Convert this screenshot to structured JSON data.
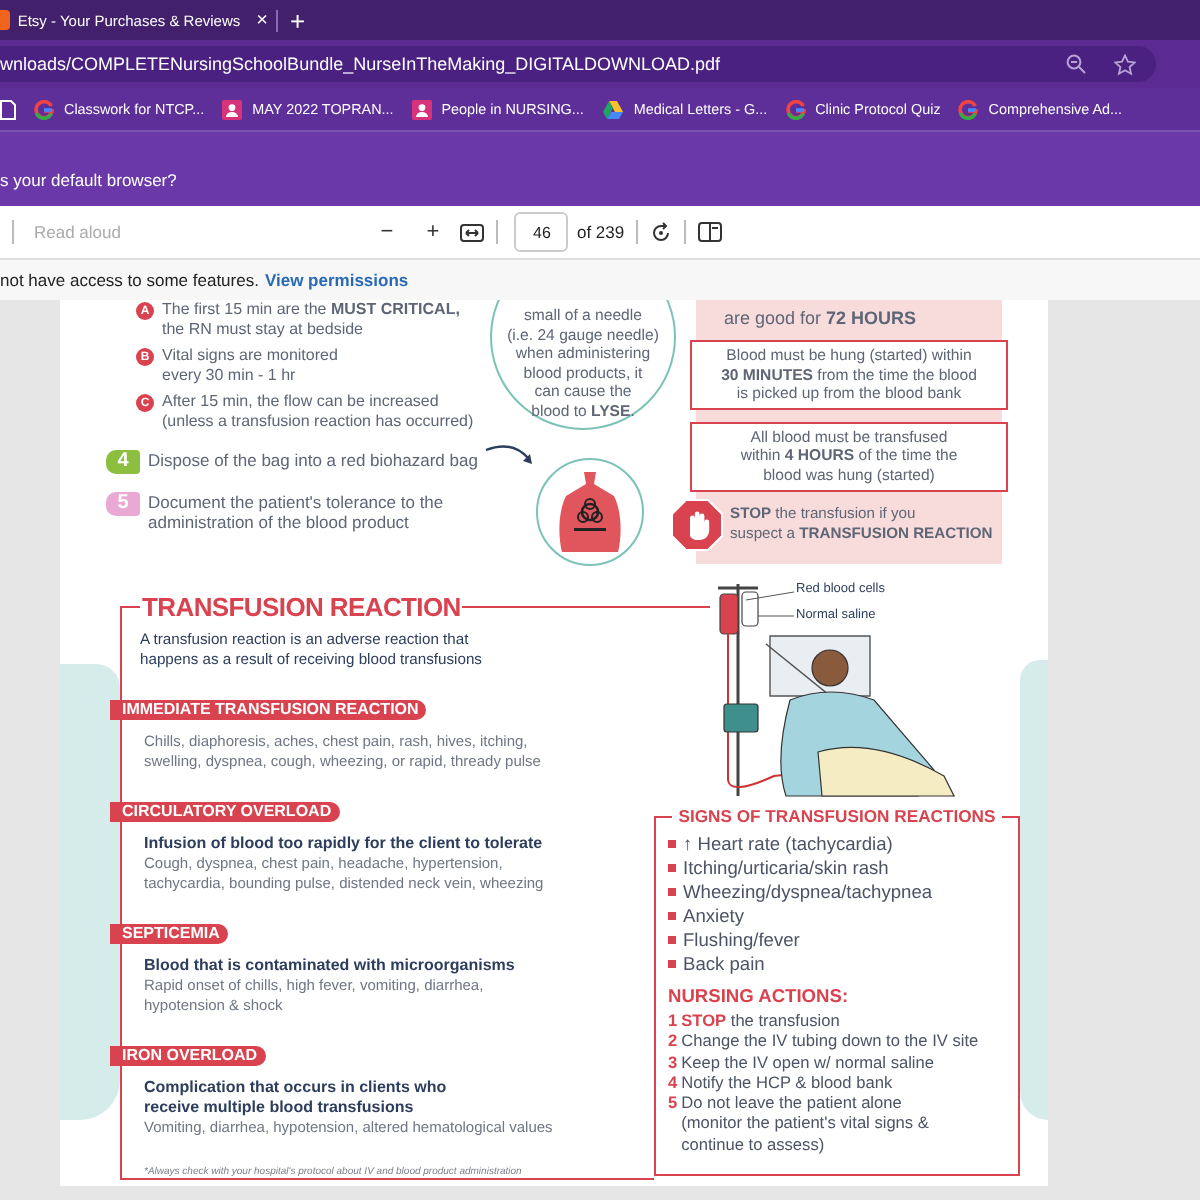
{
  "browser": {
    "tab": {
      "title": "Etsy - Your Purchases & Reviews",
      "close": "×"
    },
    "new_tab": "+",
    "address": "wnloads/COMPLETENursingSchoolBundle_NurseInTheMaking_DIGITALDOWNLOAD.pdf",
    "bookmarks": [
      {
        "kind": "page"
      },
      {
        "kind": "g",
        "label": "Classwork for NTCP..."
      },
      {
        "kind": "person",
        "label": "MAY 2022 TOPRAN..."
      },
      {
        "kind": "person",
        "label": "People in NURSING..."
      },
      {
        "kind": "drive",
        "label": "Medical Letters - G..."
      },
      {
        "kind": "g",
        "label": "Clinic Protocol Quiz"
      },
      {
        "kind": "g",
        "label": "Comprehensive Ad..."
      }
    ],
    "prompt": "s your default browser?"
  },
  "pdf_toolbar": {
    "read_aloud": {
      "label": "Read aloud",
      "disabled": true
    },
    "zoom_out": "−",
    "zoom_in": "+",
    "page": "46",
    "page_count": "of 239"
  },
  "info_bar": {
    "message": "not have access to some features.",
    "link": "View permissions"
  },
  "page": {
    "substeps": [
      {
        "marker": "A",
        "text": "The first 15 min are the **MUST CRITICAL,**\nthe RN must stay at bedside"
      },
      {
        "marker": "B",
        "text": "Vital signs are monitored\nevery 30 min - 1 hr"
      },
      {
        "marker": "C",
        "text": "After 15 min, the flow can be increased\n(unless a transfusion reaction has occurred)"
      }
    ],
    "steps": [
      {
        "number": "4",
        "color": "#8cbf3f",
        "text": "Dispose of the bag into a red biohazard bag"
      },
      {
        "number": "5",
        "color": "#e9a9d4",
        "text": "Document the patient's tolerance to the\nadministration of the blood product"
      }
    ],
    "needle_note": "small of a needle\n(i.e. 24 gauge needle)\nwhen administering\nblood products, it\ncan cause the\nblood to **LYSE**.",
    "storage_note": "are good for **72 HOURS**",
    "time_rules": [
      "Blood must be hung (started) within\n**30 MINUTES** from the time the blood\nis picked up from the blood bank",
      "All blood must be transfused\nwithin **4 HOURS** of the time the\nblood was hung (started)"
    ],
    "stop_note": "**STOP** the transfusion if you\nsuspect a **TRANSFUSION REACTION**",
    "reaction": {
      "title": "TRANSFUSION REACTION",
      "intro": "A transfusion reaction is an adverse reaction that\nhappens as a result of receiving blood transfusions",
      "types": [
        {
          "label": "IMMEDIATE TRANSFUSION REACTION",
          "details": "Chills, diaphoresis, aches, chest pain, rash, hives, itching,\nswelling, dyspnea, cough, wheezing, or rapid, thready pulse"
        },
        {
          "label": "CIRCULATORY OVERLOAD",
          "definition": "Infusion of blood too rapidly for the client to tolerate",
          "details": "Cough, dyspnea, chest pain, headache, hypertension,\ntachycardia, bounding pulse, distended neck vein, wheezing"
        },
        {
          "label": "SEPTICEMIA",
          "definition": "Blood that is contaminated with microorganisms",
          "details": "Rapid onset of chills, high fever, vomiting, diarrhea,\nhypotension & shock"
        },
        {
          "label": "IRON OVERLOAD",
          "definition": "Complication that occurs in clients who\nreceive multiple blood transfusions",
          "details": "Vomiting, diarrhea, hypotension, altered hematological values"
        }
      ],
      "footnote": "*Always check with your hospital's protocol about IV and blood product administration"
    },
    "illustration_labels": [
      "Red blood cells",
      "Normal saline"
    ],
    "signs": {
      "title": "SIGNS OF TRANSFUSION REACTIONS",
      "items": [
        "↑ Heart rate (tachycardia)",
        "Itching/urticaria/skin rash",
        "Wheezing/dyspnea/tachypnea",
        "Anxiety",
        "Flushing/fever",
        "Back pain"
      ],
      "actions_title": "NURSING ACTIONS:",
      "actions": [
        {
          "number": "1",
          "text": "**STOP** the transfusion"
        },
        {
          "number": "2",
          "text": "Change the IV tubing down to the IV site"
        },
        {
          "number": "3",
          "text": "Keep the IV open w/ normal saline"
        },
        {
          "number": "4",
          "text": "Notify the HCP & blood bank"
        },
        {
          "number": "5",
          "text": "Do not leave the patient alone\n(monitor the patient's vital signs &\ncontinue to assess)"
        }
      ]
    }
  }
}
